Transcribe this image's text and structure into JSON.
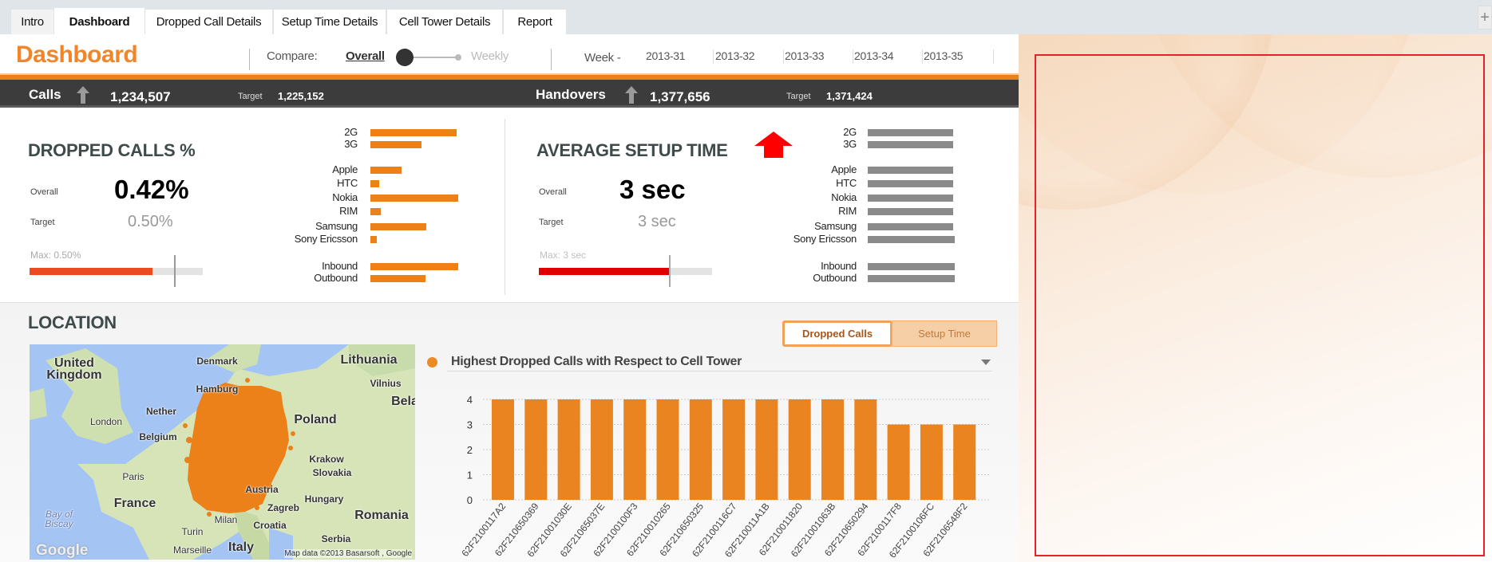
{
  "tabs": [
    "Intro",
    "Dashboard",
    "Dropped Call Details",
    "Setup Time Details",
    "Cell Tower Details",
    "Report"
  ],
  "active_tab": "Dashboard",
  "new_tab_label": "+",
  "header": {
    "title": "Dashboard",
    "compare_label": "Compare:",
    "compare_overall": "Overall",
    "compare_weekly": "Weekly",
    "week_label": "Week -",
    "weeks": [
      "2013-31",
      "2013-32",
      "2013-33",
      "2013-34",
      "2013-35"
    ]
  },
  "kpis": {
    "calls": {
      "label": "Calls",
      "value": "1,234,507",
      "target_label": "Target",
      "target": "1,225,152",
      "trend": "up"
    },
    "handovers": {
      "label": "Handovers",
      "value": "1,377,656",
      "target_label": "Target",
      "target": "1,371,424",
      "trend": "up"
    }
  },
  "dropped": {
    "title": "DROPPED CALLS %",
    "overall_label": "Overall",
    "overall": "0.42%",
    "target_label": "Target",
    "target": "0.50%",
    "max_label": "Max: 0.50%",
    "progress_fraction": 0.71,
    "bars": [
      {
        "label": "2G",
        "value": 0.98
      },
      {
        "label": "3G",
        "value": 0.58
      },
      {
        "label": "Apple",
        "value": 0.35
      },
      {
        "label": "HTC",
        "value": 0.1
      },
      {
        "label": "Nokia",
        "value": 1.0
      },
      {
        "label": "RIM",
        "value": 0.12
      },
      {
        "label": "Samsung",
        "value": 0.64
      },
      {
        "label": "Sony Ericsson",
        "value": 0.07
      },
      {
        "label": "Inbound",
        "value": 1.0
      },
      {
        "label": "Outbound",
        "value": 0.63
      }
    ]
  },
  "setup": {
    "title": "AVERAGE SETUP TIME",
    "overall_label": "Overall",
    "overall": "3 sec",
    "target_label": "Target",
    "target": "3 sec",
    "max_label": "Max: 3 sec",
    "progress_fraction": 0.75,
    "trend": "up",
    "bars": [
      {
        "label": "2G",
        "value": 0.98
      },
      {
        "label": "3G",
        "value": 0.98
      },
      {
        "label": "Apple",
        "value": 0.98
      },
      {
        "label": "HTC",
        "value": 0.98
      },
      {
        "label": "Nokia",
        "value": 0.98
      },
      {
        "label": "RIM",
        "value": 0.98
      },
      {
        "label": "Samsung",
        "value": 0.98
      },
      {
        "label": "Sony Ericsson",
        "value": 1.0
      },
      {
        "label": "Inbound",
        "value": 1.0
      },
      {
        "label": "Outbound",
        "value": 1.0
      }
    ]
  },
  "location": {
    "title": "LOCATION",
    "map_labels": [
      "United Kingdom",
      "Denmark",
      "Lithuania",
      "Hamburg",
      "Vilnius",
      "Bela",
      "Nether",
      "London",
      "Poland",
      "Belgium",
      "Krakow",
      "Paris",
      "Slovakia",
      "Austria",
      "Hungary",
      "France",
      "Zagreb",
      "Romania",
      "Bay of Biscay",
      "Milan",
      "Croatia",
      "Turin",
      "Serbia",
      "Marseille",
      "Italy"
    ],
    "map_attribution": "Map data ©2013 Basarsoft , Google",
    "map_logo": "Google"
  },
  "toggle": {
    "dropped": "Dropped Calls",
    "setup": "Setup Time",
    "selected": "Dropped Calls"
  },
  "colors": {
    "accent": "#ec8019",
    "dark": "#3c3c3c",
    "red": "#e00000",
    "gray_bar": "#8a8a8a",
    "dropped_fill": "#ea4b20"
  },
  "chart_data": {
    "type": "bar",
    "title": "Highest Dropped Calls with Respect to Cell Tower",
    "xlabel": "",
    "ylabel": "",
    "ylim": [
      0,
      4
    ],
    "yticks": [
      0,
      1,
      2,
      3,
      4
    ],
    "grid": true,
    "categories": [
      "62F2100117A2",
      "62F210650369",
      "62F21001030E",
      "62F21065037E",
      "62F2100100F3",
      "62F210010265",
      "62F210650325",
      "62F2100116C7",
      "62F210011A1B",
      "62F210011820",
      "62F21001063B",
      "62F210650294",
      "62F2100117F8",
      "62F2100106FC",
      "62F2106548F2"
    ],
    "values": [
      4,
      4,
      4,
      4,
      4,
      4,
      4,
      4,
      4,
      4,
      4,
      4,
      3,
      3,
      3
    ]
  }
}
